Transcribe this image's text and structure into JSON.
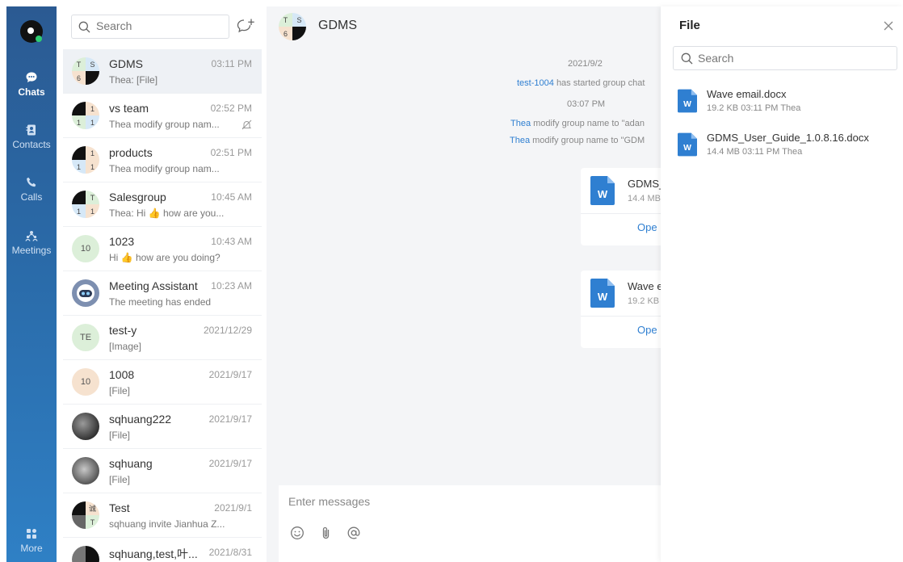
{
  "nav": {
    "items": [
      {
        "label": "Chats",
        "icon": "chat-bubble-icon"
      },
      {
        "label": "Contacts",
        "icon": "contacts-icon"
      },
      {
        "label": "Calls",
        "icon": "phone-icon"
      },
      {
        "label": "Meetings",
        "icon": "meetings-icon"
      },
      {
        "label": "More",
        "icon": "grid-icon"
      }
    ]
  },
  "list": {
    "search_placeholder": "Search",
    "conversations": [
      {
        "name": "GDMS",
        "time": "03:11 PM",
        "preview": "Thea: [File]",
        "avatar": [
          "T",
          "S",
          "6",
          ""
        ]
      },
      {
        "name": "vs team",
        "time": "02:52 PM",
        "preview": "Thea modify group nam...",
        "avatar": [
          "",
          "1",
          "1",
          "1"
        ]
      },
      {
        "name": "products",
        "time": "02:51 PM",
        "preview": "Thea modify group nam...",
        "avatar": [
          "",
          "1",
          "1",
          "1"
        ]
      },
      {
        "name": "Salesgroup",
        "time": "10:45 AM",
        "preview": "Thea: Hi 👍 how are you...",
        "avatar": [
          "",
          "T",
          "1",
          "1"
        ]
      },
      {
        "name": "1023",
        "time": "10:43 AM",
        "preview": "Hi 👍 how are you doing?",
        "avatar_text": "10"
      },
      {
        "name": "Meeting Assistant",
        "time": "10:23 AM",
        "preview": "The meeting has ended"
      },
      {
        "name": "test-y",
        "time": "2021/12/29",
        "preview": "[Image]",
        "avatar_text": "TE"
      },
      {
        "name": "1008",
        "time": "2021/9/17",
        "preview": "[File]",
        "avatar_text": "10"
      },
      {
        "name": "sqhuang222",
        "time": "2021/9/17",
        "preview": "[File]"
      },
      {
        "name": "sqhuang",
        "time": "2021/9/17",
        "preview": "[File]"
      },
      {
        "name": "Test",
        "time": "2021/9/1",
        "preview": "sqhuang invite Jianhua Z...",
        "avatar": [
          "",
          "诚",
          "",
          "T"
        ]
      },
      {
        "name": "sqhuang,test,叶...",
        "time": "2021/8/31",
        "preview": ""
      }
    ]
  },
  "chat": {
    "title": "GDMS",
    "avatar": [
      "T",
      "S",
      "6",
      ""
    ],
    "date": "2021/9/2",
    "event1_user": "test-1004",
    "event1_text": "has started group chat",
    "time": "03:07 PM",
    "event2_user": "Thea",
    "event2_text": "modify group name to \"adan",
    "event3_user": "Thea",
    "event3_text": "modify group name to \"GDM",
    "file1": {
      "name": "GDMS_",
      "size": "14.4 MB",
      "open": "Ope"
    },
    "file2": {
      "name": "Wave e",
      "size": "19.2 KB",
      "open": "Ope"
    },
    "input_placeholder": "Enter messages"
  },
  "panel": {
    "title": "File",
    "search_placeholder": "Search",
    "files": [
      {
        "name": "Wave email.docx",
        "meta": "19.2 KB 03:11 PM Thea"
      },
      {
        "name": "GDMS_User_Guide_1.0.8.16.docx",
        "meta": "14.4 MB 03:11 PM Thea"
      }
    ]
  },
  "colors": {
    "accent": "#2f7fd1",
    "rail_top": "#2b5a92",
    "rail_bottom": "#2f80c5",
    "word_icon": "#2f7fd1"
  }
}
